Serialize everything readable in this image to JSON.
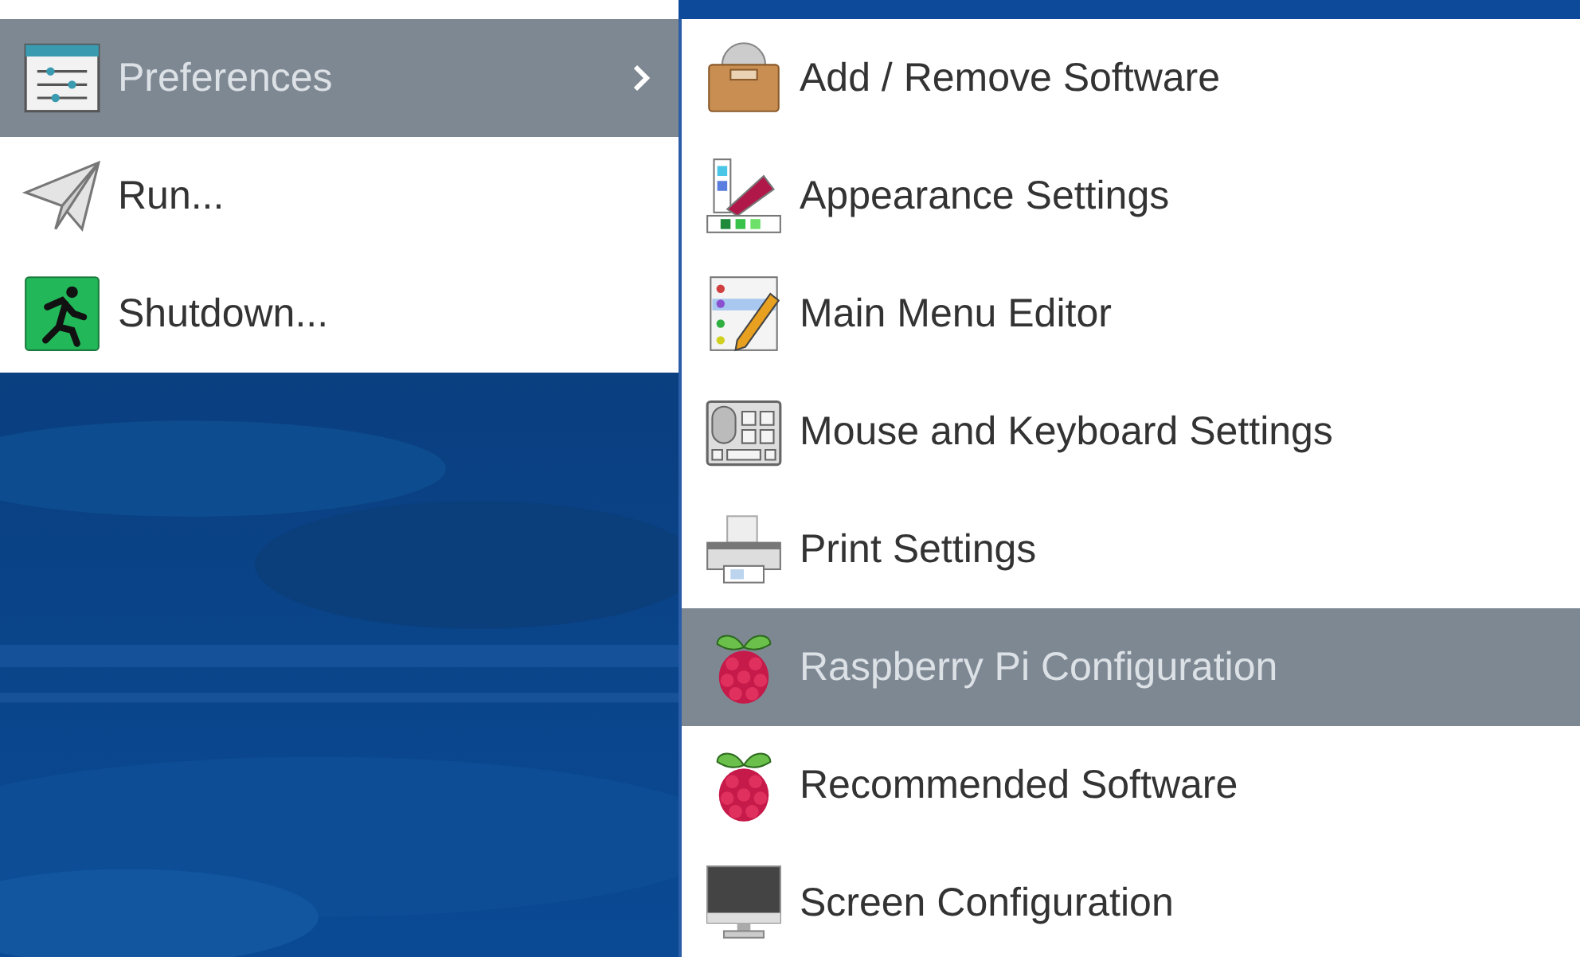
{
  "main_menu": {
    "items": [
      {
        "label": "Preferences",
        "kind": "sliders",
        "selected": true,
        "submenu": true
      },
      {
        "label": "Run...",
        "kind": "plane",
        "selected": false,
        "submenu": false
      },
      {
        "label": "Shutdown...",
        "kind": "runner",
        "selected": false,
        "submenu": false
      }
    ]
  },
  "submenu": {
    "items": [
      {
        "label": "Add / Remove Software",
        "kind": "box",
        "selected": false
      },
      {
        "label": "Appearance Settings",
        "kind": "palette",
        "selected": false
      },
      {
        "label": "Main Menu Editor",
        "kind": "editor",
        "selected": false
      },
      {
        "label": "Mouse and Keyboard Settings",
        "kind": "keyboard",
        "selected": false
      },
      {
        "label": "Print Settings",
        "kind": "printer",
        "selected": false
      },
      {
        "label": "Raspberry Pi Configuration",
        "kind": "raspberry",
        "selected": true
      },
      {
        "label": "Recommended Software",
        "kind": "raspberry",
        "selected": false
      },
      {
        "label": "Screen Configuration",
        "kind": "monitor",
        "selected": false
      }
    ]
  }
}
